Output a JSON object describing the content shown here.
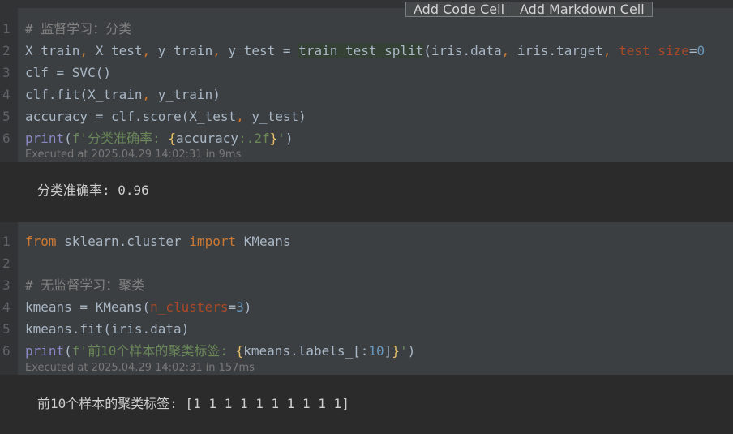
{
  "toolbar": {
    "add_code_cell": "Add Code Cell",
    "add_markdown_cell": "Add Markdown Cell"
  },
  "cell1": {
    "line_numbers": [
      "1",
      "2",
      "3",
      "4",
      "5",
      "6"
    ],
    "l1": "# 监督学习：分类",
    "l2": {
      "a": "X_train",
      "c1": ", ",
      "b": "X_test",
      "c2": ", ",
      "c": "y_train",
      "c3": ", ",
      "d": "y_test",
      "eq": " = ",
      "fn": "train_test_split",
      "p1": "(iris.data",
      "c4": ", ",
      "e": "iris.target",
      "c5": ", ",
      "param": "test_size",
      "eq2": "=",
      "num": "0"
    },
    "l3": "clf = SVC()",
    "l4": {
      "a": "clf.fit(X_train",
      "c": ", ",
      "b": "y_train)"
    },
    "l5": {
      "a": "accuracy = clf.score(X_test",
      "c": ", ",
      "b": "y_test)"
    },
    "l6": {
      "fn": "print",
      "p": "(",
      "s1": "f'分类准确率: ",
      "b1": "{",
      "v": "accuracy",
      "fmt": ":.2f",
      "b2": "}",
      "s2": "'",
      "p2": ")"
    },
    "exec": "Executed at 2025.04.29 14:02:31 in 9ms"
  },
  "output1": "分类准确率: 0.96",
  "cell2": {
    "line_numbers": [
      "1",
      "2",
      "3",
      "4",
      "5",
      "6"
    ],
    "l1": {
      "kw1": "from",
      "m": " sklearn.cluster ",
      "kw2": "import",
      "c": " KMeans"
    },
    "l2": "",
    "l3": "# 无监督学习：聚类",
    "l4": {
      "a": "kmeans = KMeans(",
      "param": "n_clusters",
      "eq": "=",
      "num": "3",
      "p": ")"
    },
    "l5": "kmeans.fit(iris.data)",
    "l6": {
      "fn": "print",
      "p": "(",
      "s1": "f'前10个样本的聚类标签: ",
      "b1": "{",
      "v": "kmeans.labels_[:",
      "num": "10",
      "v2": "]",
      "b2": "}",
      "s2": "'",
      "p2": ")"
    },
    "exec": "Executed at 2025.04.29 14:02:31 in 157ms"
  },
  "output2": "前10个样本的聚类标签: [1 1 1 1 1 1 1 1 1 1]"
}
